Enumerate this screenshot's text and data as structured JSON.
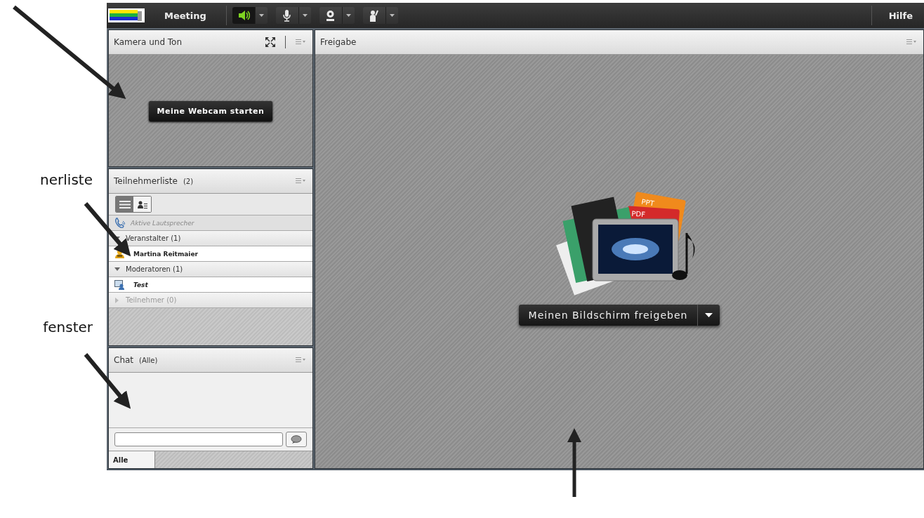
{
  "annotations": {
    "labels": [
      {
        "text": "nerliste"
      },
      {
        "text": "fenster"
      }
    ],
    "arrows": [
      {
        "kind": "diagonal"
      },
      {
        "kind": "diagonal"
      },
      {
        "kind": "diagonal"
      },
      {
        "kind": "vertical"
      }
    ]
  },
  "toolbar": {
    "menu": "Meeting",
    "buttons": [
      {
        "kind": "speaker",
        "on": true
      },
      {
        "kind": "microphone",
        "on": false
      },
      {
        "kind": "webcam",
        "on": false
      },
      {
        "kind": "hand",
        "on": false
      }
    ],
    "help": "Hilfe"
  },
  "camera_pod": {
    "title": "Kamera und Ton",
    "button": "Meine Webcam starten"
  },
  "attendee_pod": {
    "title": "Teilnehmerliste",
    "count": "(2)",
    "views": [
      {
        "kind": "list",
        "selected": true
      },
      {
        "kind": "person",
        "selected": false
      }
    ],
    "active_speakers": "Aktive Lautsprecher",
    "groups": [
      {
        "label": "Veranstalter (1)",
        "expanded": true,
        "members": [
          {
            "name": "Martina Reitmaier",
            "kind": "host"
          }
        ]
      },
      {
        "label": "Moderatoren (1)",
        "expanded": true,
        "members": [
          {
            "name": "Test",
            "kind": "presenter"
          }
        ]
      },
      {
        "label": "Teilnehmer (0)",
        "expanded": false
      }
    ]
  },
  "chat_pod": {
    "title": "Chat",
    "scope": "(Alle)",
    "tabs": [
      {
        "label": "Alle",
        "selected": true
      }
    ]
  },
  "share_pod": {
    "title": "Freigabe",
    "illustration_labels": [
      "PPT",
      "PDF"
    ],
    "button": "Meinen Bildschirm freigeben"
  }
}
